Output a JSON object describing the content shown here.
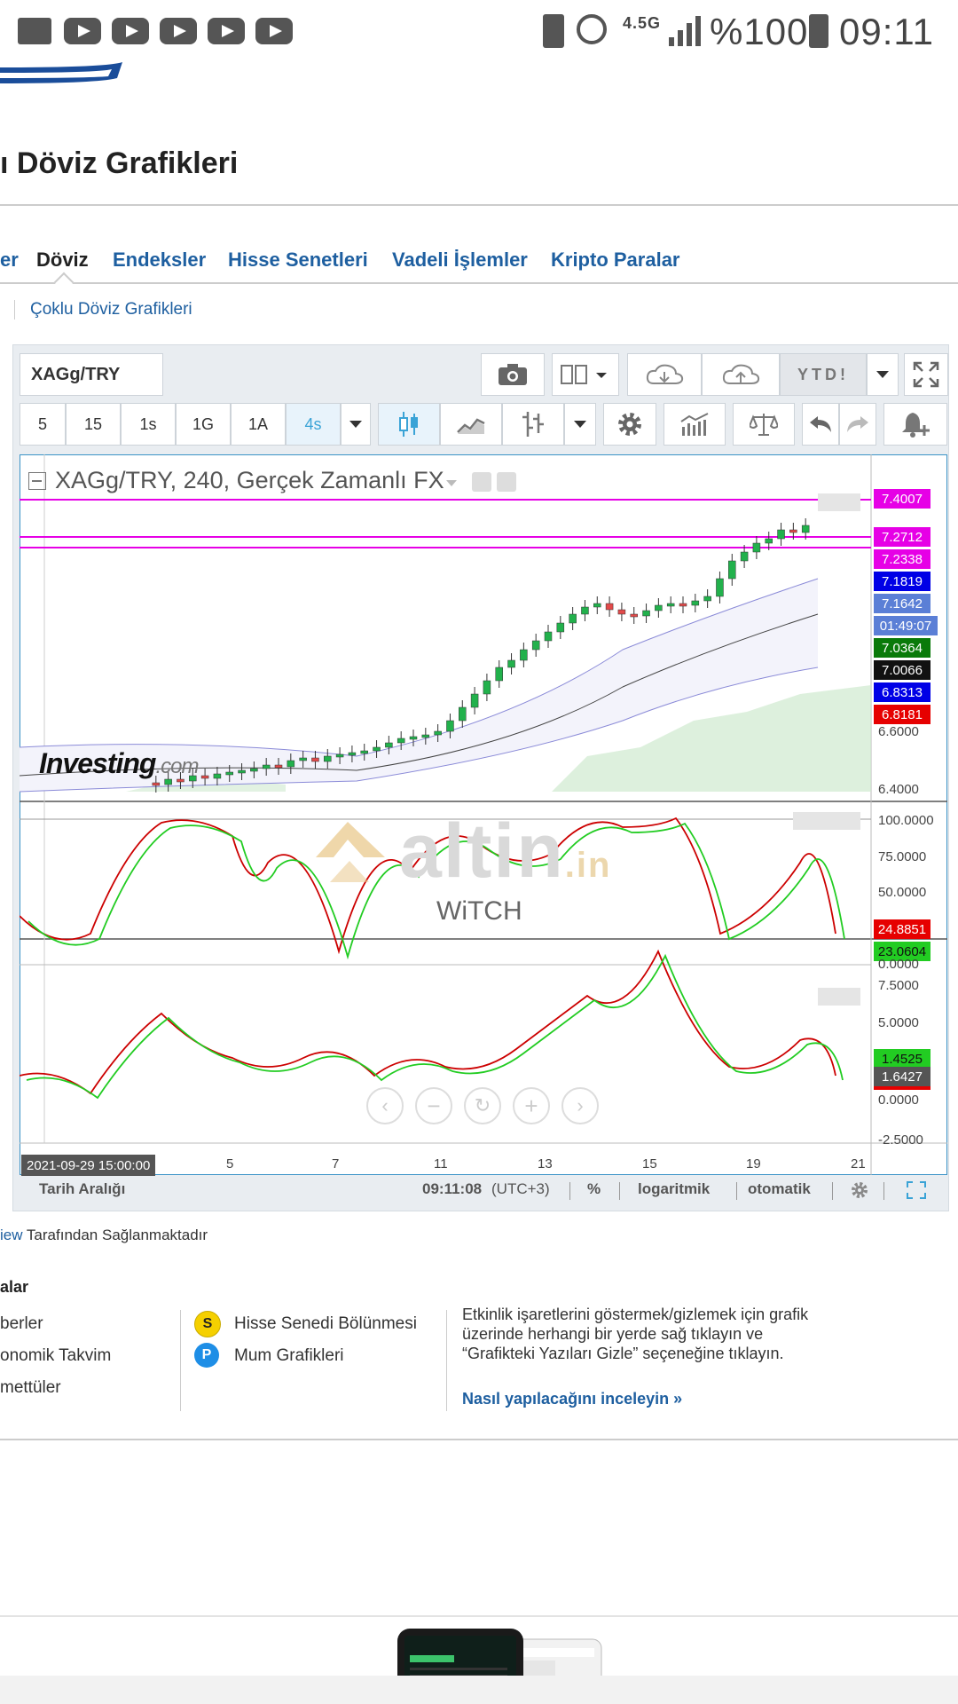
{
  "status_bar": {
    "network": "4.5G",
    "battery": "%100",
    "time": "09:11"
  },
  "page": {
    "title": "ı Döviz Grafikleri",
    "sub_link": "Çoklu Döviz Grafikleri",
    "nav": [
      {
        "label": "er",
        "active": false
      },
      {
        "label": "Döviz",
        "active": true
      },
      {
        "label": "Endeksler",
        "active": false
      },
      {
        "label": "Hisse Senetleri",
        "active": false
      },
      {
        "label": "Vadeli İşlemler",
        "active": false
      },
      {
        "label": "Kripto Paralar",
        "active": false
      }
    ]
  },
  "toolbar": {
    "symbol": "XAGg/TRY",
    "range_button": "YTD!",
    "intervals": [
      "5",
      "15",
      "1s",
      "1G",
      "1A",
      "4s"
    ],
    "selected_interval": "4s",
    "icons": [
      "camera-icon",
      "layout-icon",
      "cloud-download-icon",
      "cloud-upload-icon",
      "fullscreen-icon",
      "candles-icon",
      "line-chart-icon",
      "bar-type-icon",
      "gear-icon",
      "indicators-icon",
      "compare-icon",
      "undo-icon",
      "redo-icon",
      "alert-icon"
    ]
  },
  "chart": {
    "legend": "XAGg/TRY, 240, Gerçek Zamanlı FX",
    "watermark": "Investing",
    "watermark_suffix": ".com",
    "overlay_brand": "altin",
    "overlay_brand_suffix": ".in",
    "overlay_text": "WiTCH",
    "crosshair_date": "2021-09-29 15:00:00",
    "price_axis": {
      "tags": [
        {
          "value": "7.4007",
          "color": "#e600e6"
        },
        {
          "value": "7.2712",
          "color": "#e600e6"
        },
        {
          "value": "7.2338",
          "color": "#e600e6"
        },
        {
          "value": "7.1819",
          "color": "#0000e6"
        },
        {
          "value": "7.1642",
          "color": "#5b7fd6"
        },
        {
          "value": "01:49:07",
          "color": "#5b7fd6"
        },
        {
          "value": "7.0364",
          "color": "#0a7a0a"
        },
        {
          "value": "7.0066",
          "color": "#111111"
        },
        {
          "value": "6.8313",
          "color": "#0000e6"
        },
        {
          "value": "6.8181",
          "color": "#e60000"
        }
      ],
      "labels": [
        "6.6000",
        "6.4000"
      ]
    },
    "stoch_axis": {
      "labels": [
        "100.0000",
        "75.0000",
        "50.0000",
        "0.0000"
      ],
      "tags": [
        {
          "value": "24.8851",
          "color": "#e60000"
        },
        {
          "value": "23.0604",
          "color": "#22cc22"
        }
      ]
    },
    "macd_axis": {
      "labels": [
        "7.5000",
        "5.0000",
        "0.0000",
        "-2.5000"
      ],
      "tags": [
        {
          "value": "1.4525",
          "color": "#22cc22"
        },
        {
          "value": "1.6427",
          "color": "#555555"
        }
      ]
    },
    "x_axis": [
      "5",
      "7",
      "11",
      "13",
      "15",
      "19",
      "21"
    ]
  },
  "bottom_bar": {
    "range_label": "Tarih Aralığı",
    "time": "09:11:08",
    "tz": "(UTC+3)",
    "percent": "%",
    "log": "logaritmik",
    "auto": "otomatik"
  },
  "attribution": {
    "link": "iew",
    "text": " Tarafından Sağlanmaktadır"
  },
  "legend": {
    "title": "alar",
    "col1": [
      "berler",
      "onomik Takvim",
      "mettüler"
    ],
    "col2": [
      {
        "badge": "S",
        "label": "Hisse Senedi Bölünmesi",
        "color": "#f5d000"
      },
      {
        "badge": "P",
        "label": "Mum Grafikleri",
        "color": "#1e8ee6"
      }
    ],
    "desc": "Etkinlik işaretlerini göstermek/gizlemek için grafik üzerinde herhangi bir yerde sağ tıklayın ve “Grafikteki Yazıları Gizle” seçeneğine tıklayın.",
    "link": "Nasıl yapılacağını inceleyin »"
  }
}
